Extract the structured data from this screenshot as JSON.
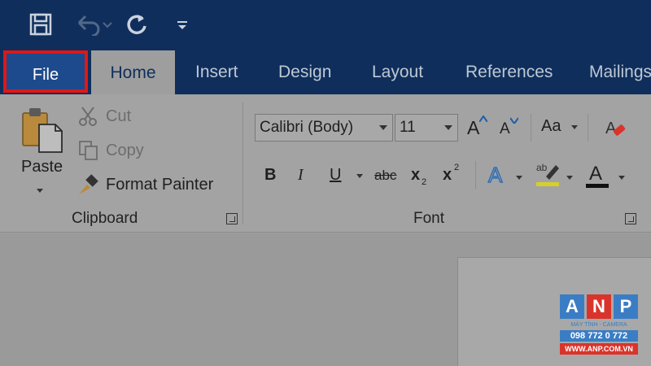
{
  "colors": {
    "title_bar": "#0f2e5b",
    "file_tab": "#1d4a8c",
    "highlight_border": "#e01717",
    "ribbon": "#a3a3a3",
    "logo_blue": "#3b7dc4",
    "logo_red": "#d9342b"
  },
  "quick_access": {
    "save_icon": "save-icon",
    "undo_icon": "undo-icon",
    "redo_icon": "redo-icon",
    "customize_icon": "customize-qat-icon"
  },
  "tabs": [
    {
      "label": "File"
    },
    {
      "label": "Home"
    },
    {
      "label": "Insert"
    },
    {
      "label": "Design"
    },
    {
      "label": "Layout"
    },
    {
      "label": "References"
    },
    {
      "label": "Mailings"
    }
  ],
  "clipboard": {
    "paste": "Paste",
    "cut": "Cut",
    "copy": "Copy",
    "format_painter": "Format Painter",
    "group_label": "Clipboard"
  },
  "font": {
    "font_name": "Calibri (Body)",
    "font_size": "11",
    "case_label": "Aa",
    "bold": "B",
    "italic": "I",
    "underline": "U",
    "strikethrough": "abc",
    "subscript": "x",
    "subscript_mark": "2",
    "superscript": "x",
    "superscript_mark": "2",
    "grow": "A",
    "shrink": "A",
    "font_color": "A",
    "text_effects": "A",
    "group_label": "Font"
  },
  "watermark": {
    "letters": [
      "A",
      "N",
      "P"
    ],
    "line1": "MÁY TÍNH - CAMERA",
    "phone": "098 772 0 772",
    "site": "WWW.ANP.COM.VN"
  }
}
